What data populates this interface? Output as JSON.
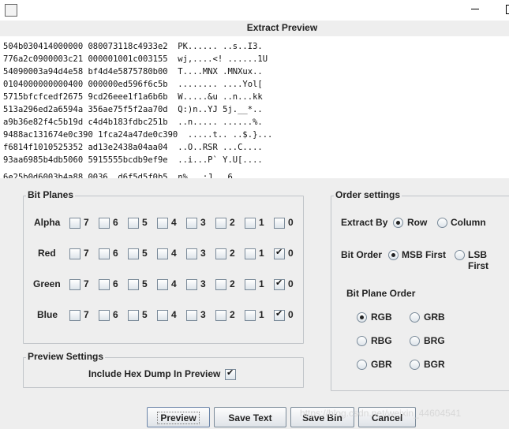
{
  "window": {
    "title": ""
  },
  "preview": {
    "title": "Extract Preview",
    "rows": [
      "504b030414000000 080073118c4933e2  PK...... ..s..I3.",
      "776a2c0900003c21 000001001c003155  wj,....<! ......1U",
      "54090003a94d4e58 bf4d4e5875780b00  T....MNX .MNXux..",
      "0104000000000400 000000ed596f6c5b  ........ ....Yol[",
      "5715bfcfcedf2675 9cd26eee1f1a6b6b  W.....&u ..n...kk",
      "513a296ed2a6594a 356ae75f5f2aa70d  Q:)n..YJ 5j.__*..",
      "a9b36e82f4c5b19d c4d4b183fdbc251b  ..n..... ......%.",
      "9488ac131674e0c390 1fca24a47de0c390  .....t.. ..$.}...",
      "f6814f1010525352 ad13e2438a04aa04  ..O..RSR ...C....",
      "93aa6985b4db5060 5915555bcdb9ef9e  ..i...P` Y.U[....",
      "6e25b0d6003b4a88 0036..d6f5d5f0b5  n%...;J. .6......"
    ]
  },
  "bit_planes": {
    "title": "Bit Planes",
    "bits": [
      "7",
      "6",
      "5",
      "4",
      "3",
      "2",
      "1",
      "0"
    ],
    "channels": [
      {
        "name": "Alpha",
        "checked": []
      },
      {
        "name": "Red",
        "checked": [
          "0"
        ]
      },
      {
        "name": "Green",
        "checked": [
          "0"
        ]
      },
      {
        "name": "Blue",
        "checked": [
          "0"
        ]
      }
    ]
  },
  "order_settings": {
    "title": "Order settings",
    "extract_by_label": "Extract By",
    "extract_by_options": [
      "Row",
      "Column"
    ],
    "extract_by_selected": "Row",
    "bit_order_label": "Bit Order",
    "bit_order_options": [
      "MSB First",
      "LSB First"
    ],
    "bit_order_selected": "MSB First",
    "bit_plane_order_label": "Bit Plane Order",
    "bit_plane_order_options": [
      "RGB",
      "GRB",
      "RBG",
      "BRG",
      "GBR",
      "BGR"
    ],
    "bit_plane_order_selected": "RGB"
  },
  "preview_settings": {
    "title": "Preview Settings",
    "hex_dump_label": "Include Hex Dump In Preview",
    "hex_dump_checked": true
  },
  "buttons": {
    "preview": "Preview",
    "save_text": "Save Text",
    "save_bin": "Save Bin",
    "cancel": "Cancel"
  },
  "watermark": "https://blog.csdn.net/weixin_44604541"
}
